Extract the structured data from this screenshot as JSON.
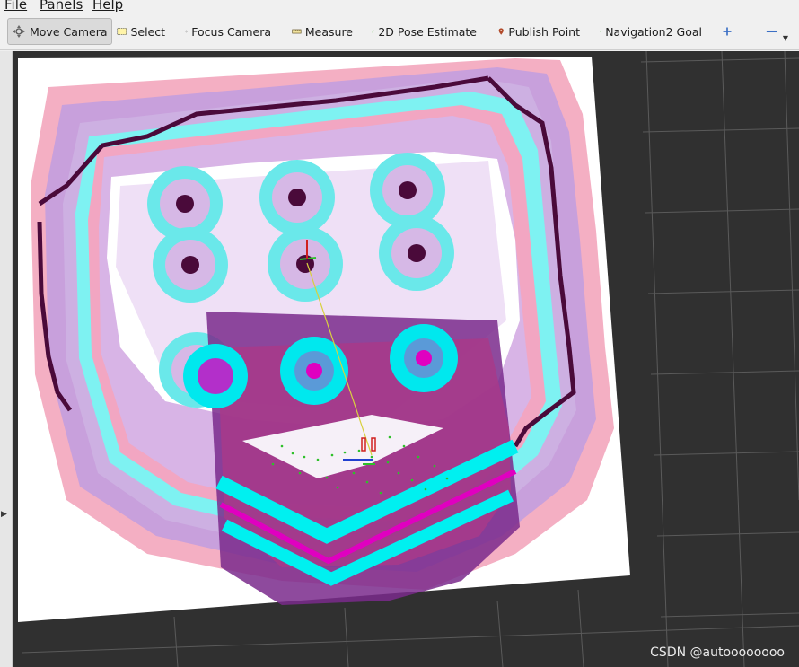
{
  "menu": {
    "file": "File",
    "panels": "Panels",
    "help": "Help"
  },
  "toolbar": {
    "move_camera": "Move Camera",
    "select": "Select",
    "focus_camera": "Focus Camera",
    "measure": "Measure",
    "pose_estimate": "2D Pose Estimate",
    "publish_point": "Publish Point",
    "nav_goal": "Navigation2 Goal",
    "add_tool_icon": "plus-icon",
    "remove_tool_icon": "minus-icon",
    "active_tool": "Move Camera"
  },
  "colors": {
    "viewport_bg": "#303030",
    "grid_line": "#5a5a5a",
    "map_free": "#ffffff",
    "costmap_inflation": "#c39ad8",
    "costmap_edge": "#f2a0b8",
    "costmap_inscribed": "#78f0f0",
    "obstacle": "#4a0a3a",
    "local_costmap": "#6a1a7a",
    "local_cyan": "#00f0f0",
    "local_magenta": "#e000c0",
    "accent_green": "#44cc22"
  },
  "watermark": "CSDN @autoooooooo"
}
